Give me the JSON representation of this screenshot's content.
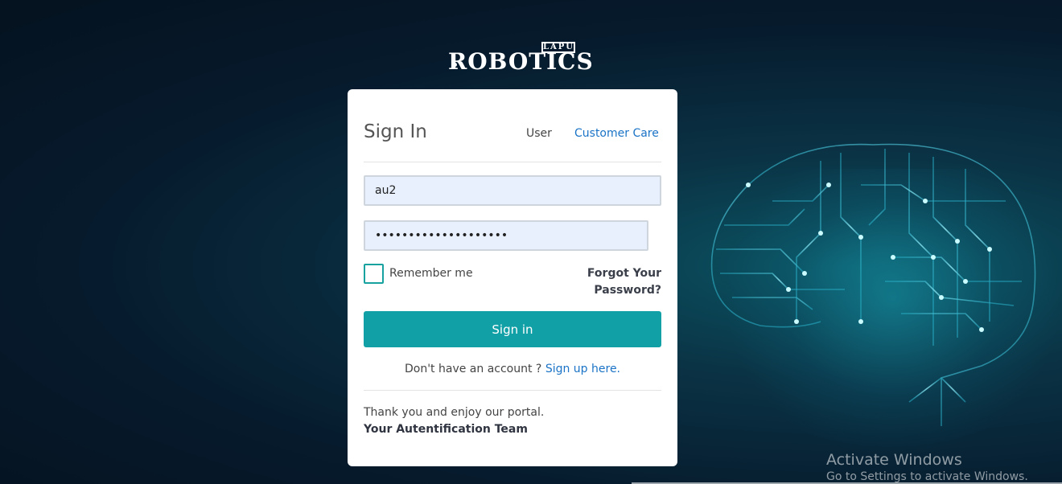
{
  "brand": {
    "badge": "LAPU",
    "name": "ROBOTICS"
  },
  "signin": {
    "title": "Sign In",
    "tabs": {
      "user": "User",
      "customer_care": "Customer Care"
    },
    "username_value": "au2",
    "password_value": "••••••••••••••••••••",
    "remember_label": "Remember me",
    "forgot_label": "Forgot Your Password?",
    "button_label": "Sign in",
    "no_account_text": "Don't have an account ? ",
    "signup_link": "Sign up here.",
    "thanks_text": "Thank you and enjoy our portal.",
    "team_text": "Your Autentification Team"
  },
  "watermark": {
    "title": "Activate Windows",
    "subtitle": "Go to Settings to activate Windows."
  },
  "colors": {
    "accent": "#12a0a7",
    "link": "#1a73c6",
    "input_bg": "#e8f0fe"
  },
  "icons": {
    "brain": "circuit-brain-icon",
    "logo": "robotics-logo-icon"
  }
}
